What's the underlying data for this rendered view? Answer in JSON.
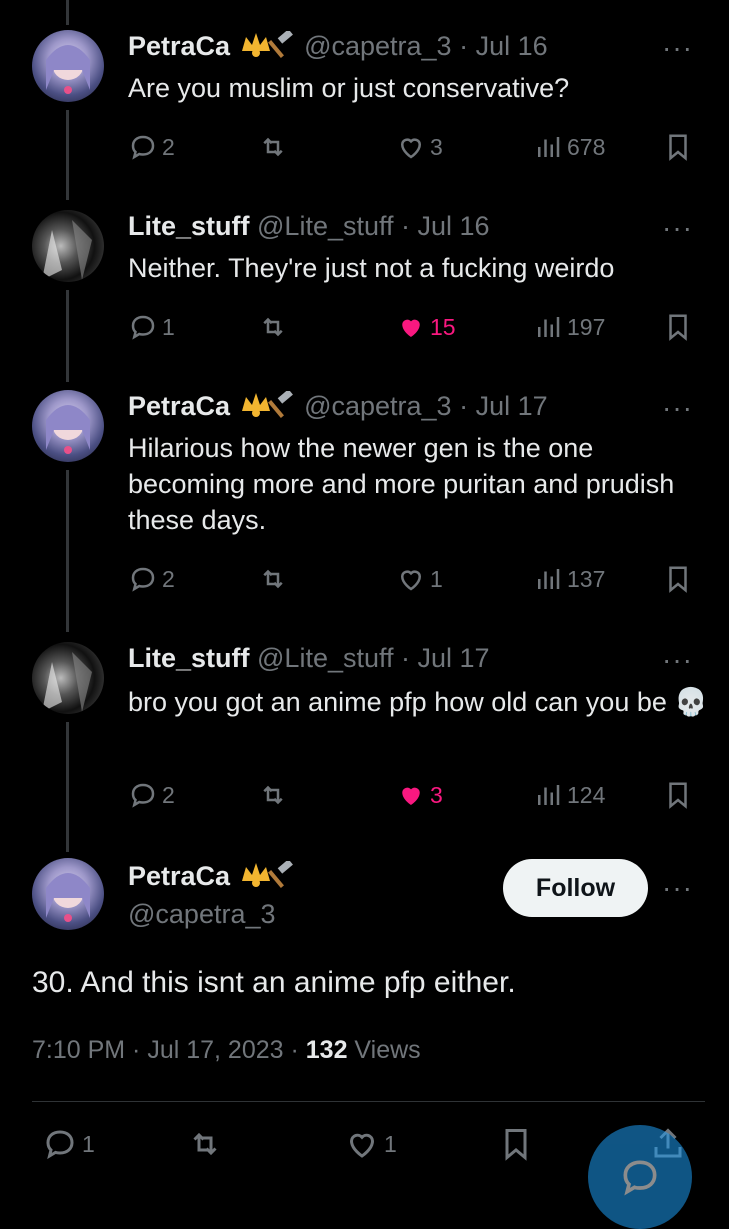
{
  "replies": [
    {
      "name": "PetraCa",
      "handle": "@capetra_3",
      "date": "Jul 16",
      "text": "Are you muslim or just conservative?",
      "replies": "2",
      "likes": "3",
      "views": "678",
      "liked": false
    },
    {
      "name": "Lite_stuff",
      "handle": "@Lite_stuff",
      "date": "Jul 16",
      "text": "Neither. They're just not a fucking weirdo",
      "replies": "1",
      "likes": "15",
      "views": "197",
      "liked": true
    },
    {
      "name": "PetraCa",
      "handle": "@capetra_3",
      "date": "Jul 17",
      "text": "Hilarious how the newer gen is the one becoming more and more puritan and prudish these days.",
      "replies": "2",
      "likes": "1",
      "views": "137",
      "liked": false
    },
    {
      "name": "Lite_stuff",
      "handle": "@Lite_stuff",
      "date": "Jul 17",
      "text": "bro you got an anime pfp how old can you be 💀",
      "replies": "2",
      "likes": "3",
      "views": "124",
      "liked": true
    }
  ],
  "main": {
    "name": "PetraCa",
    "handle": "@capetra_3",
    "follow_label": "Follow",
    "text": "30. And this isnt an anime pfp either.",
    "timestamp": "7:10 PM · Jul 17, 2023 · ",
    "views_count": "132",
    "views_label": " Views",
    "replies": "1",
    "likes": "1"
  },
  "meta_separator": " · ",
  "more_label": "···",
  "colors": {
    "like": "#f91880",
    "muted": "#71767b",
    "accent": "#1d9bf0"
  }
}
